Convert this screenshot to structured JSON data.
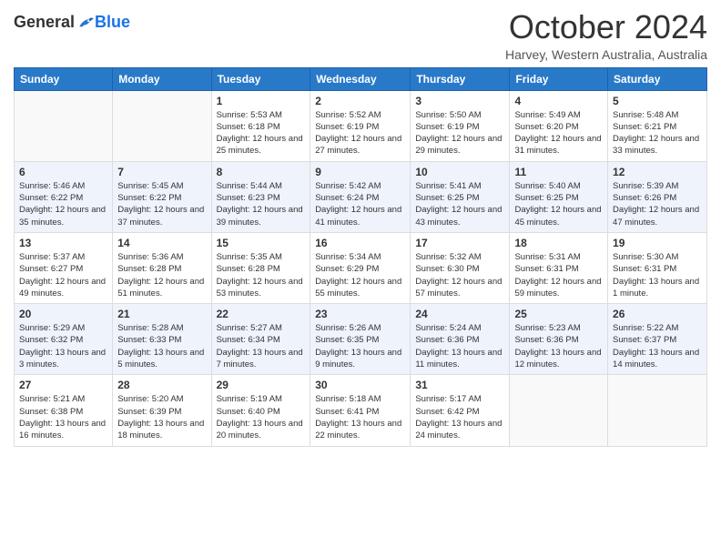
{
  "logo": {
    "general": "General",
    "blue": "Blue"
  },
  "title": "October 2024",
  "subtitle": "Harvey, Western Australia, Australia",
  "days": [
    "Sunday",
    "Monday",
    "Tuesday",
    "Wednesday",
    "Thursday",
    "Friday",
    "Saturday"
  ],
  "weeks": [
    [
      {
        "day": "",
        "sunrise": "",
        "sunset": "",
        "daylight": ""
      },
      {
        "day": "",
        "sunrise": "",
        "sunset": "",
        "daylight": ""
      },
      {
        "day": "1",
        "sunrise": "Sunrise: 5:53 AM",
        "sunset": "Sunset: 6:18 PM",
        "daylight": "Daylight: 12 hours and 25 minutes."
      },
      {
        "day": "2",
        "sunrise": "Sunrise: 5:52 AM",
        "sunset": "Sunset: 6:19 PM",
        "daylight": "Daylight: 12 hours and 27 minutes."
      },
      {
        "day": "3",
        "sunrise": "Sunrise: 5:50 AM",
        "sunset": "Sunset: 6:19 PM",
        "daylight": "Daylight: 12 hours and 29 minutes."
      },
      {
        "day": "4",
        "sunrise": "Sunrise: 5:49 AM",
        "sunset": "Sunset: 6:20 PM",
        "daylight": "Daylight: 12 hours and 31 minutes."
      },
      {
        "day": "5",
        "sunrise": "Sunrise: 5:48 AM",
        "sunset": "Sunset: 6:21 PM",
        "daylight": "Daylight: 12 hours and 33 minutes."
      }
    ],
    [
      {
        "day": "6",
        "sunrise": "Sunrise: 5:46 AM",
        "sunset": "Sunset: 6:22 PM",
        "daylight": "Daylight: 12 hours and 35 minutes."
      },
      {
        "day": "7",
        "sunrise": "Sunrise: 5:45 AM",
        "sunset": "Sunset: 6:22 PM",
        "daylight": "Daylight: 12 hours and 37 minutes."
      },
      {
        "day": "8",
        "sunrise": "Sunrise: 5:44 AM",
        "sunset": "Sunset: 6:23 PM",
        "daylight": "Daylight: 12 hours and 39 minutes."
      },
      {
        "day": "9",
        "sunrise": "Sunrise: 5:42 AM",
        "sunset": "Sunset: 6:24 PM",
        "daylight": "Daylight: 12 hours and 41 minutes."
      },
      {
        "day": "10",
        "sunrise": "Sunrise: 5:41 AM",
        "sunset": "Sunset: 6:25 PM",
        "daylight": "Daylight: 12 hours and 43 minutes."
      },
      {
        "day": "11",
        "sunrise": "Sunrise: 5:40 AM",
        "sunset": "Sunset: 6:25 PM",
        "daylight": "Daylight: 12 hours and 45 minutes."
      },
      {
        "day": "12",
        "sunrise": "Sunrise: 5:39 AM",
        "sunset": "Sunset: 6:26 PM",
        "daylight": "Daylight: 12 hours and 47 minutes."
      }
    ],
    [
      {
        "day": "13",
        "sunrise": "Sunrise: 5:37 AM",
        "sunset": "Sunset: 6:27 PM",
        "daylight": "Daylight: 12 hours and 49 minutes."
      },
      {
        "day": "14",
        "sunrise": "Sunrise: 5:36 AM",
        "sunset": "Sunset: 6:28 PM",
        "daylight": "Daylight: 12 hours and 51 minutes."
      },
      {
        "day": "15",
        "sunrise": "Sunrise: 5:35 AM",
        "sunset": "Sunset: 6:28 PM",
        "daylight": "Daylight: 12 hours and 53 minutes."
      },
      {
        "day": "16",
        "sunrise": "Sunrise: 5:34 AM",
        "sunset": "Sunset: 6:29 PM",
        "daylight": "Daylight: 12 hours and 55 minutes."
      },
      {
        "day": "17",
        "sunrise": "Sunrise: 5:32 AM",
        "sunset": "Sunset: 6:30 PM",
        "daylight": "Daylight: 12 hours and 57 minutes."
      },
      {
        "day": "18",
        "sunrise": "Sunrise: 5:31 AM",
        "sunset": "Sunset: 6:31 PM",
        "daylight": "Daylight: 12 hours and 59 minutes."
      },
      {
        "day": "19",
        "sunrise": "Sunrise: 5:30 AM",
        "sunset": "Sunset: 6:31 PM",
        "daylight": "Daylight: 13 hours and 1 minute."
      }
    ],
    [
      {
        "day": "20",
        "sunrise": "Sunrise: 5:29 AM",
        "sunset": "Sunset: 6:32 PM",
        "daylight": "Daylight: 13 hours and 3 minutes."
      },
      {
        "day": "21",
        "sunrise": "Sunrise: 5:28 AM",
        "sunset": "Sunset: 6:33 PM",
        "daylight": "Daylight: 13 hours and 5 minutes."
      },
      {
        "day": "22",
        "sunrise": "Sunrise: 5:27 AM",
        "sunset": "Sunset: 6:34 PM",
        "daylight": "Daylight: 13 hours and 7 minutes."
      },
      {
        "day": "23",
        "sunrise": "Sunrise: 5:26 AM",
        "sunset": "Sunset: 6:35 PM",
        "daylight": "Daylight: 13 hours and 9 minutes."
      },
      {
        "day": "24",
        "sunrise": "Sunrise: 5:24 AM",
        "sunset": "Sunset: 6:36 PM",
        "daylight": "Daylight: 13 hours and 11 minutes."
      },
      {
        "day": "25",
        "sunrise": "Sunrise: 5:23 AM",
        "sunset": "Sunset: 6:36 PM",
        "daylight": "Daylight: 13 hours and 12 minutes."
      },
      {
        "day": "26",
        "sunrise": "Sunrise: 5:22 AM",
        "sunset": "Sunset: 6:37 PM",
        "daylight": "Daylight: 13 hours and 14 minutes."
      }
    ],
    [
      {
        "day": "27",
        "sunrise": "Sunrise: 5:21 AM",
        "sunset": "Sunset: 6:38 PM",
        "daylight": "Daylight: 13 hours and 16 minutes."
      },
      {
        "day": "28",
        "sunrise": "Sunrise: 5:20 AM",
        "sunset": "Sunset: 6:39 PM",
        "daylight": "Daylight: 13 hours and 18 minutes."
      },
      {
        "day": "29",
        "sunrise": "Sunrise: 5:19 AM",
        "sunset": "Sunset: 6:40 PM",
        "daylight": "Daylight: 13 hours and 20 minutes."
      },
      {
        "day": "30",
        "sunrise": "Sunrise: 5:18 AM",
        "sunset": "Sunset: 6:41 PM",
        "daylight": "Daylight: 13 hours and 22 minutes."
      },
      {
        "day": "31",
        "sunrise": "Sunrise: 5:17 AM",
        "sunset": "Sunset: 6:42 PM",
        "daylight": "Daylight: 13 hours and 24 minutes."
      },
      {
        "day": "",
        "sunrise": "",
        "sunset": "",
        "daylight": ""
      },
      {
        "day": "",
        "sunrise": "",
        "sunset": "",
        "daylight": ""
      }
    ]
  ]
}
